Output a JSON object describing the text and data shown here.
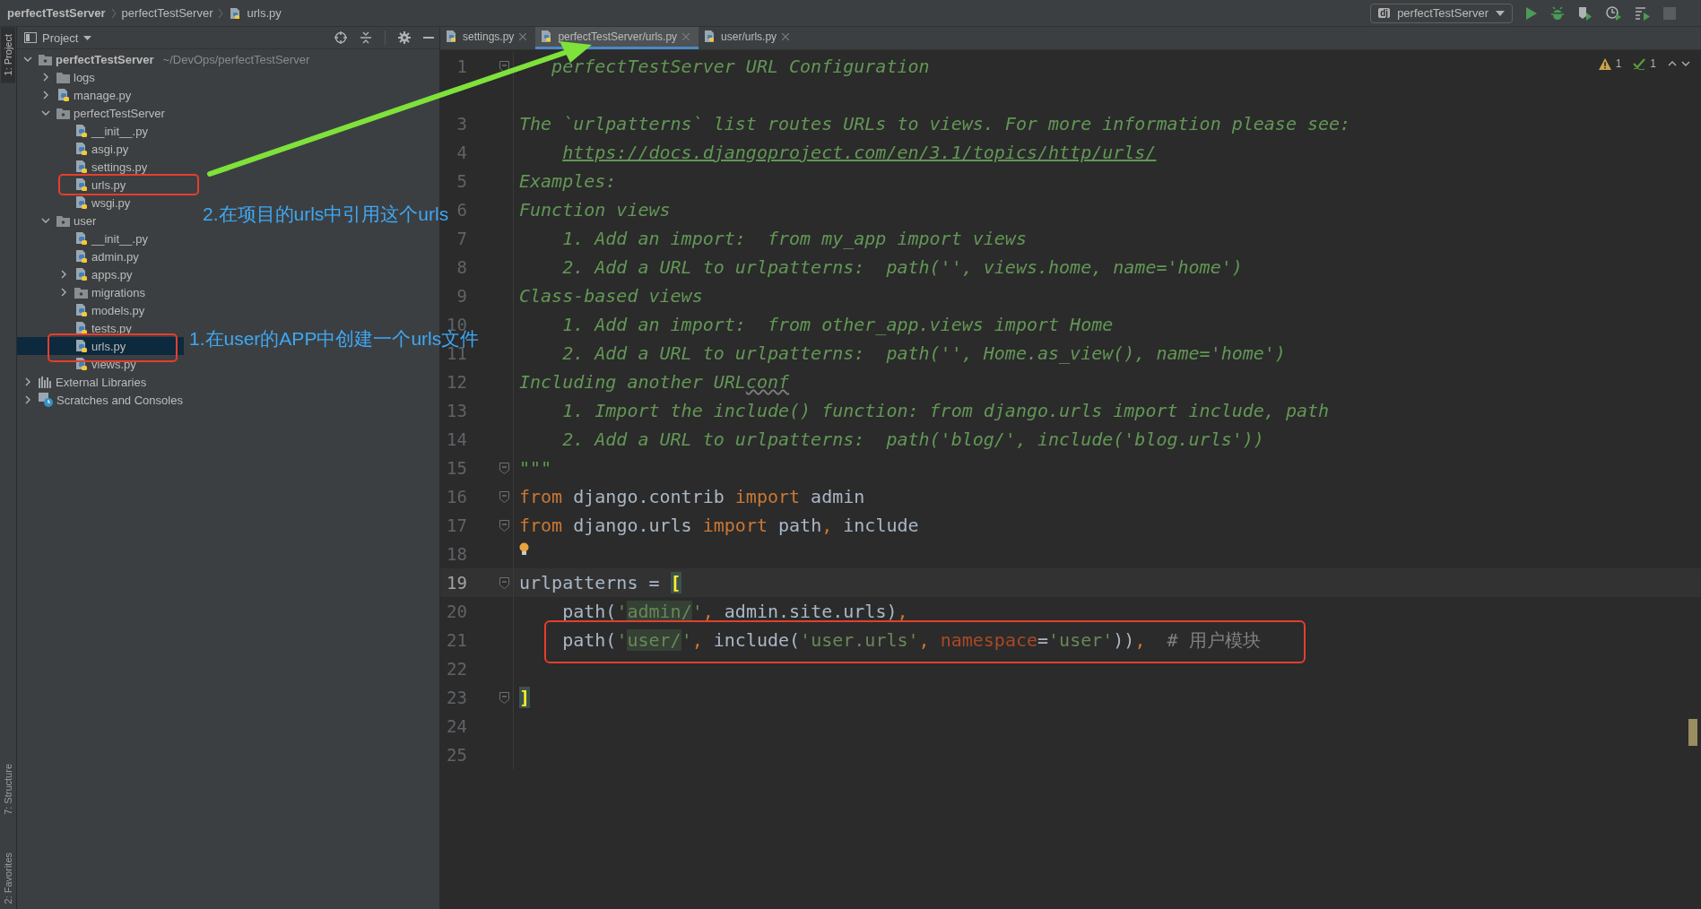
{
  "breadcrumbs": [
    "perfectTestServer",
    "perfectTestServer",
    "urls.py"
  ],
  "run_config": {
    "label": "perfectTestServer",
    "badge": "dj"
  },
  "left_stripe": {
    "top": [
      "1: Project"
    ],
    "bottom": [
      "7: Structure",
      "2: Favorites"
    ]
  },
  "project_panel": {
    "title": "Project"
  },
  "tree": [
    {
      "label": "perfectTestServer",
      "path": "~/DevOps/perfectTestServer",
      "kind": "root",
      "expanded": true,
      "selected": false,
      "children": [
        {
          "label": "logs",
          "kind": "folder",
          "expanded": false,
          "selected": false
        },
        {
          "label": "manage.py",
          "kind": "pyfile",
          "expanded": false,
          "selected": false
        },
        {
          "label": "perfectTestServer",
          "kind": "module",
          "expanded": true,
          "selected": false,
          "children": [
            {
              "label": "__init__.py",
              "kind": "pyfile",
              "selected": false
            },
            {
              "label": "asgi.py",
              "kind": "pyfile",
              "selected": false
            },
            {
              "label": "settings.py",
              "kind": "pyfile",
              "selected": false
            },
            {
              "label": "urls.py",
              "kind": "pyfile",
              "selected": false
            },
            {
              "label": "wsgi.py",
              "kind": "pyfile",
              "selected": false
            }
          ]
        },
        {
          "label": "user",
          "kind": "module",
          "expanded": true,
          "selected": false,
          "children": [
            {
              "label": "__init__.py",
              "kind": "pyfile",
              "selected": false
            },
            {
              "label": "admin.py",
              "kind": "pyfile",
              "selected": false
            },
            {
              "label": "apps.py",
              "kind": "pyfile",
              "expanded": false,
              "selected": false
            },
            {
              "label": "migrations",
              "kind": "module",
              "expanded": false,
              "selected": false
            },
            {
              "label": "models.py",
              "kind": "pyfile",
              "selected": false
            },
            {
              "label": "tests.py",
              "kind": "pyfile",
              "selected": false
            },
            {
              "label": "urls.py",
              "kind": "pyfile",
              "selected": true
            },
            {
              "label": "views.py",
              "kind": "pyfile",
              "selected": false
            }
          ]
        }
      ]
    },
    {
      "label": "External Libraries",
      "kind": "library",
      "expanded": false,
      "selected": false
    },
    {
      "label": "Scratches and Consoles",
      "kind": "scratch",
      "expanded": false,
      "selected": false
    }
  ],
  "tabs": [
    {
      "label": "settings.py",
      "selected": false
    },
    {
      "label": "perfectTestServer/urls.py",
      "selected": true
    },
    {
      "label": "user/urls.py",
      "selected": false
    }
  ],
  "inspections": {
    "warnings": "1",
    "weak_warnings": "1"
  },
  "lines": [
    {
      "number": "1",
      "fold": true,
      "tokens": [
        {
          "kind": "docstart",
          "text": "perfectTestServer URL Configuration"
        }
      ]
    },
    {
      "number": "3",
      "gap_before": true,
      "tokens": [
        {
          "kind": "doc",
          "text": "The `urlpatterns` list routes URLs to views. For more information please see:"
        }
      ]
    },
    {
      "number": "4",
      "tokens": [
        {
          "kind": "link",
          "text": "https://docs.djangoproject.com/en/3.1/topics/http/urls/"
        }
      ]
    },
    {
      "number": "5",
      "tokens": [
        {
          "kind": "doc",
          "text": "Examples:"
        }
      ]
    },
    {
      "number": "6",
      "tokens": [
        {
          "kind": "doc",
          "text": "Function views"
        }
      ]
    },
    {
      "number": "7",
      "tokens": [
        {
          "kind": "doc",
          "text": "    1. Add an import:  from my_app import views"
        }
      ]
    },
    {
      "number": "8",
      "tokens": [
        {
          "kind": "doc",
          "text": "    2. Add a URL to urlpatterns:  path('', views.home, name='home')"
        }
      ]
    },
    {
      "number": "9",
      "tokens": [
        {
          "kind": "doc",
          "text": "Class-based views"
        }
      ]
    },
    {
      "number": "10",
      "tokens": [
        {
          "kind": "doc",
          "text": "    1. Add an import:  from other_app.views import Home"
        }
      ]
    },
    {
      "number": "11",
      "tokens": [
        {
          "kind": "doc",
          "text": "    2. Add a URL to urlpatterns:  path('', Home.as_view(), name='home')"
        }
      ]
    },
    {
      "number": "12",
      "tokens": [
        {
          "kind": "doc",
          "text": "Including another URL"
        },
        {
          "kind": "typo",
          "text": "conf"
        }
      ]
    },
    {
      "number": "13",
      "tokens": [
        {
          "kind": "doc",
          "text": "    1. Import the include() function: from django.urls import include, path"
        }
      ]
    },
    {
      "number": "14",
      "tokens": [
        {
          "kind": "doc",
          "text": "    2. Add a URL to urlpatterns:  path('blog/', include('blog.urls'))"
        }
      ]
    },
    {
      "number": "15",
      "fold": true,
      "tokens": [
        {
          "kind": "doc",
          "text": "\"\"\""
        }
      ]
    },
    {
      "number": "16",
      "fold": true,
      "tokens": [
        {
          "kind": "kw",
          "text": "from"
        },
        {
          "kind": "plain",
          "text": " django.contrib "
        },
        {
          "kind": "kw",
          "text": "import"
        },
        {
          "kind": "plain",
          "text": " admin"
        }
      ]
    },
    {
      "number": "17",
      "fold": true,
      "tokens": [
        {
          "kind": "kw",
          "text": "from"
        },
        {
          "kind": "plain",
          "text": " django.urls "
        },
        {
          "kind": "kw",
          "text": "import"
        },
        {
          "kind": "plain",
          "text": " path"
        },
        {
          "kind": "kw",
          "text": ","
        },
        {
          "kind": "plain",
          "text": " include"
        }
      ]
    },
    {
      "number": "18",
      "bulb": true
    },
    {
      "number": "19",
      "fold": true,
      "current": true,
      "tokens": [
        {
          "kind": "plain",
          "text": "urlpatterns = "
        },
        {
          "kind": "brace",
          "text": "["
        }
      ]
    },
    {
      "number": "20",
      "tokens": [
        {
          "kind": "plain",
          "text": "    path("
        },
        {
          "kind": "str",
          "text": "'"
        },
        {
          "kind": "match",
          "text": "admin/"
        },
        {
          "kind": "str",
          "text": "'"
        },
        {
          "kind": "kw",
          "text": ","
        },
        {
          "kind": "plain",
          "text": " admin.site.urls)"
        },
        {
          "kind": "kw",
          "text": ","
        }
      ]
    },
    {
      "number": "21",
      "tokens": [
        {
          "kind": "plain",
          "text": "    path("
        },
        {
          "kind": "str",
          "text": "'"
        },
        {
          "kind": "match",
          "text": "user/"
        },
        {
          "kind": "str",
          "text": "'"
        },
        {
          "kind": "kw",
          "text": ","
        },
        {
          "kind": "plain",
          "text": " include("
        },
        {
          "kind": "str",
          "text": "'user.urls'"
        },
        {
          "kind": "kw",
          "text": ","
        },
        {
          "kind": "param",
          "text": " namespace"
        },
        {
          "kind": "plain",
          "text": "="
        },
        {
          "kind": "str",
          "text": "'user'"
        },
        {
          "kind": "plain",
          "text": "))"
        },
        {
          "kind": "kw",
          "text": ","
        },
        {
          "kind": "comment",
          "text": "  # 用户模块"
        }
      ]
    },
    {
      "number": "22"
    },
    {
      "number": "23",
      "fold": true,
      "tokens": [
        {
          "kind": "brace",
          "text": "]"
        }
      ]
    },
    {
      "number": "24"
    },
    {
      "number": "25"
    }
  ],
  "annotations": [
    {
      "text": "2.在项目的urls中引用这个urls"
    },
    {
      "text": "1.在user的APP中创建一个urls文件"
    }
  ]
}
